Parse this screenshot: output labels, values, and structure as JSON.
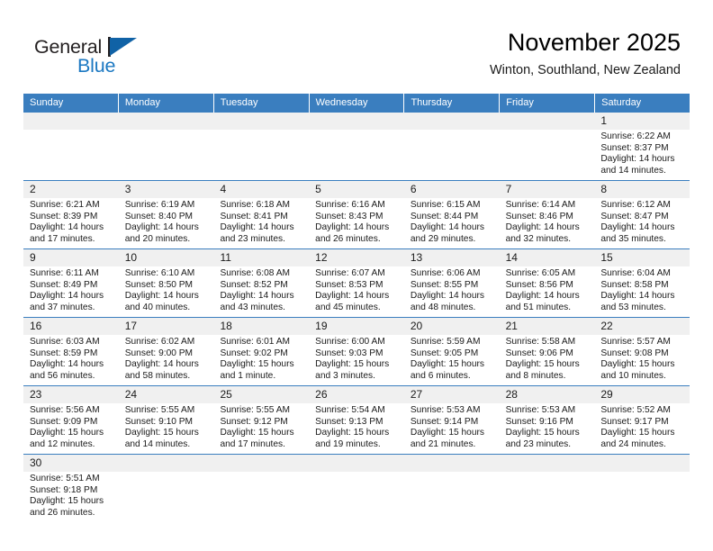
{
  "brand": {
    "name_top": "General",
    "name_bottom": "Blue",
    "accent_color": "#1b78c2",
    "flag_color": "#1062a6"
  },
  "header": {
    "title": "November 2025",
    "subtitle": "Winton, Southland, New Zealand"
  },
  "theme": {
    "header_blue": "#3a7ebf",
    "daynum_band": "#f0f0f0",
    "row_rule": "#3a7ebf"
  },
  "calendar": {
    "weekdays": [
      "Sunday",
      "Monday",
      "Tuesday",
      "Wednesday",
      "Thursday",
      "Friday",
      "Saturday"
    ],
    "weeks": [
      [
        {
          "day": "",
          "sunrise": "",
          "sunset": "",
          "daylight": "",
          "daylight2": ""
        },
        {
          "day": "",
          "sunrise": "",
          "sunset": "",
          "daylight": "",
          "daylight2": ""
        },
        {
          "day": "",
          "sunrise": "",
          "sunset": "",
          "daylight": "",
          "daylight2": ""
        },
        {
          "day": "",
          "sunrise": "",
          "sunset": "",
          "daylight": "",
          "daylight2": ""
        },
        {
          "day": "",
          "sunrise": "",
          "sunset": "",
          "daylight": "",
          "daylight2": ""
        },
        {
          "day": "",
          "sunrise": "",
          "sunset": "",
          "daylight": "",
          "daylight2": ""
        },
        {
          "day": "1",
          "sunrise": "Sunrise: 6:22 AM",
          "sunset": "Sunset: 8:37 PM",
          "daylight": "Daylight: 14 hours",
          "daylight2": "and 14 minutes."
        }
      ],
      [
        {
          "day": "2",
          "sunrise": "Sunrise: 6:21 AM",
          "sunset": "Sunset: 8:39 PM",
          "daylight": "Daylight: 14 hours",
          "daylight2": "and 17 minutes."
        },
        {
          "day": "3",
          "sunrise": "Sunrise: 6:19 AM",
          "sunset": "Sunset: 8:40 PM",
          "daylight": "Daylight: 14 hours",
          "daylight2": "and 20 minutes."
        },
        {
          "day": "4",
          "sunrise": "Sunrise: 6:18 AM",
          "sunset": "Sunset: 8:41 PM",
          "daylight": "Daylight: 14 hours",
          "daylight2": "and 23 minutes."
        },
        {
          "day": "5",
          "sunrise": "Sunrise: 6:16 AM",
          "sunset": "Sunset: 8:43 PM",
          "daylight": "Daylight: 14 hours",
          "daylight2": "and 26 minutes."
        },
        {
          "day": "6",
          "sunrise": "Sunrise: 6:15 AM",
          "sunset": "Sunset: 8:44 PM",
          "daylight": "Daylight: 14 hours",
          "daylight2": "and 29 minutes."
        },
        {
          "day": "7",
          "sunrise": "Sunrise: 6:14 AM",
          "sunset": "Sunset: 8:46 PM",
          "daylight": "Daylight: 14 hours",
          "daylight2": "and 32 minutes."
        },
        {
          "day": "8",
          "sunrise": "Sunrise: 6:12 AM",
          "sunset": "Sunset: 8:47 PM",
          "daylight": "Daylight: 14 hours",
          "daylight2": "and 35 minutes."
        }
      ],
      [
        {
          "day": "9",
          "sunrise": "Sunrise: 6:11 AM",
          "sunset": "Sunset: 8:49 PM",
          "daylight": "Daylight: 14 hours",
          "daylight2": "and 37 minutes."
        },
        {
          "day": "10",
          "sunrise": "Sunrise: 6:10 AM",
          "sunset": "Sunset: 8:50 PM",
          "daylight": "Daylight: 14 hours",
          "daylight2": "and 40 minutes."
        },
        {
          "day": "11",
          "sunrise": "Sunrise: 6:08 AM",
          "sunset": "Sunset: 8:52 PM",
          "daylight": "Daylight: 14 hours",
          "daylight2": "and 43 minutes."
        },
        {
          "day": "12",
          "sunrise": "Sunrise: 6:07 AM",
          "sunset": "Sunset: 8:53 PM",
          "daylight": "Daylight: 14 hours",
          "daylight2": "and 45 minutes."
        },
        {
          "day": "13",
          "sunrise": "Sunrise: 6:06 AM",
          "sunset": "Sunset: 8:55 PM",
          "daylight": "Daylight: 14 hours",
          "daylight2": "and 48 minutes."
        },
        {
          "day": "14",
          "sunrise": "Sunrise: 6:05 AM",
          "sunset": "Sunset: 8:56 PM",
          "daylight": "Daylight: 14 hours",
          "daylight2": "and 51 minutes."
        },
        {
          "day": "15",
          "sunrise": "Sunrise: 6:04 AM",
          "sunset": "Sunset: 8:58 PM",
          "daylight": "Daylight: 14 hours",
          "daylight2": "and 53 minutes."
        }
      ],
      [
        {
          "day": "16",
          "sunrise": "Sunrise: 6:03 AM",
          "sunset": "Sunset: 8:59 PM",
          "daylight": "Daylight: 14 hours",
          "daylight2": "and 56 minutes."
        },
        {
          "day": "17",
          "sunrise": "Sunrise: 6:02 AM",
          "sunset": "Sunset: 9:00 PM",
          "daylight": "Daylight: 14 hours",
          "daylight2": "and 58 minutes."
        },
        {
          "day": "18",
          "sunrise": "Sunrise: 6:01 AM",
          "sunset": "Sunset: 9:02 PM",
          "daylight": "Daylight: 15 hours",
          "daylight2": "and 1 minute."
        },
        {
          "day": "19",
          "sunrise": "Sunrise: 6:00 AM",
          "sunset": "Sunset: 9:03 PM",
          "daylight": "Daylight: 15 hours",
          "daylight2": "and 3 minutes."
        },
        {
          "day": "20",
          "sunrise": "Sunrise: 5:59 AM",
          "sunset": "Sunset: 9:05 PM",
          "daylight": "Daylight: 15 hours",
          "daylight2": "and 6 minutes."
        },
        {
          "day": "21",
          "sunrise": "Sunrise: 5:58 AM",
          "sunset": "Sunset: 9:06 PM",
          "daylight": "Daylight: 15 hours",
          "daylight2": "and 8 minutes."
        },
        {
          "day": "22",
          "sunrise": "Sunrise: 5:57 AM",
          "sunset": "Sunset: 9:08 PM",
          "daylight": "Daylight: 15 hours",
          "daylight2": "and 10 minutes."
        }
      ],
      [
        {
          "day": "23",
          "sunrise": "Sunrise: 5:56 AM",
          "sunset": "Sunset: 9:09 PM",
          "daylight": "Daylight: 15 hours",
          "daylight2": "and 12 minutes."
        },
        {
          "day": "24",
          "sunrise": "Sunrise: 5:55 AM",
          "sunset": "Sunset: 9:10 PM",
          "daylight": "Daylight: 15 hours",
          "daylight2": "and 14 minutes."
        },
        {
          "day": "25",
          "sunrise": "Sunrise: 5:55 AM",
          "sunset": "Sunset: 9:12 PM",
          "daylight": "Daylight: 15 hours",
          "daylight2": "and 17 minutes."
        },
        {
          "day": "26",
          "sunrise": "Sunrise: 5:54 AM",
          "sunset": "Sunset: 9:13 PM",
          "daylight": "Daylight: 15 hours",
          "daylight2": "and 19 minutes."
        },
        {
          "day": "27",
          "sunrise": "Sunrise: 5:53 AM",
          "sunset": "Sunset: 9:14 PM",
          "daylight": "Daylight: 15 hours",
          "daylight2": "and 21 minutes."
        },
        {
          "day": "28",
          "sunrise": "Sunrise: 5:53 AM",
          "sunset": "Sunset: 9:16 PM",
          "daylight": "Daylight: 15 hours",
          "daylight2": "and 23 minutes."
        },
        {
          "day": "29",
          "sunrise": "Sunrise: 5:52 AM",
          "sunset": "Sunset: 9:17 PM",
          "daylight": "Daylight: 15 hours",
          "daylight2": "and 24 minutes."
        }
      ],
      [
        {
          "day": "30",
          "sunrise": "Sunrise: 5:51 AM",
          "sunset": "Sunset: 9:18 PM",
          "daylight": "Daylight: 15 hours",
          "daylight2": "and 26 minutes."
        },
        {
          "day": "",
          "sunrise": "",
          "sunset": "",
          "daylight": "",
          "daylight2": ""
        },
        {
          "day": "",
          "sunrise": "",
          "sunset": "",
          "daylight": "",
          "daylight2": ""
        },
        {
          "day": "",
          "sunrise": "",
          "sunset": "",
          "daylight": "",
          "daylight2": ""
        },
        {
          "day": "",
          "sunrise": "",
          "sunset": "",
          "daylight": "",
          "daylight2": ""
        },
        {
          "day": "",
          "sunrise": "",
          "sunset": "",
          "daylight": "",
          "daylight2": ""
        },
        {
          "day": "",
          "sunrise": "",
          "sunset": "",
          "daylight": "",
          "daylight2": ""
        }
      ]
    ]
  }
}
